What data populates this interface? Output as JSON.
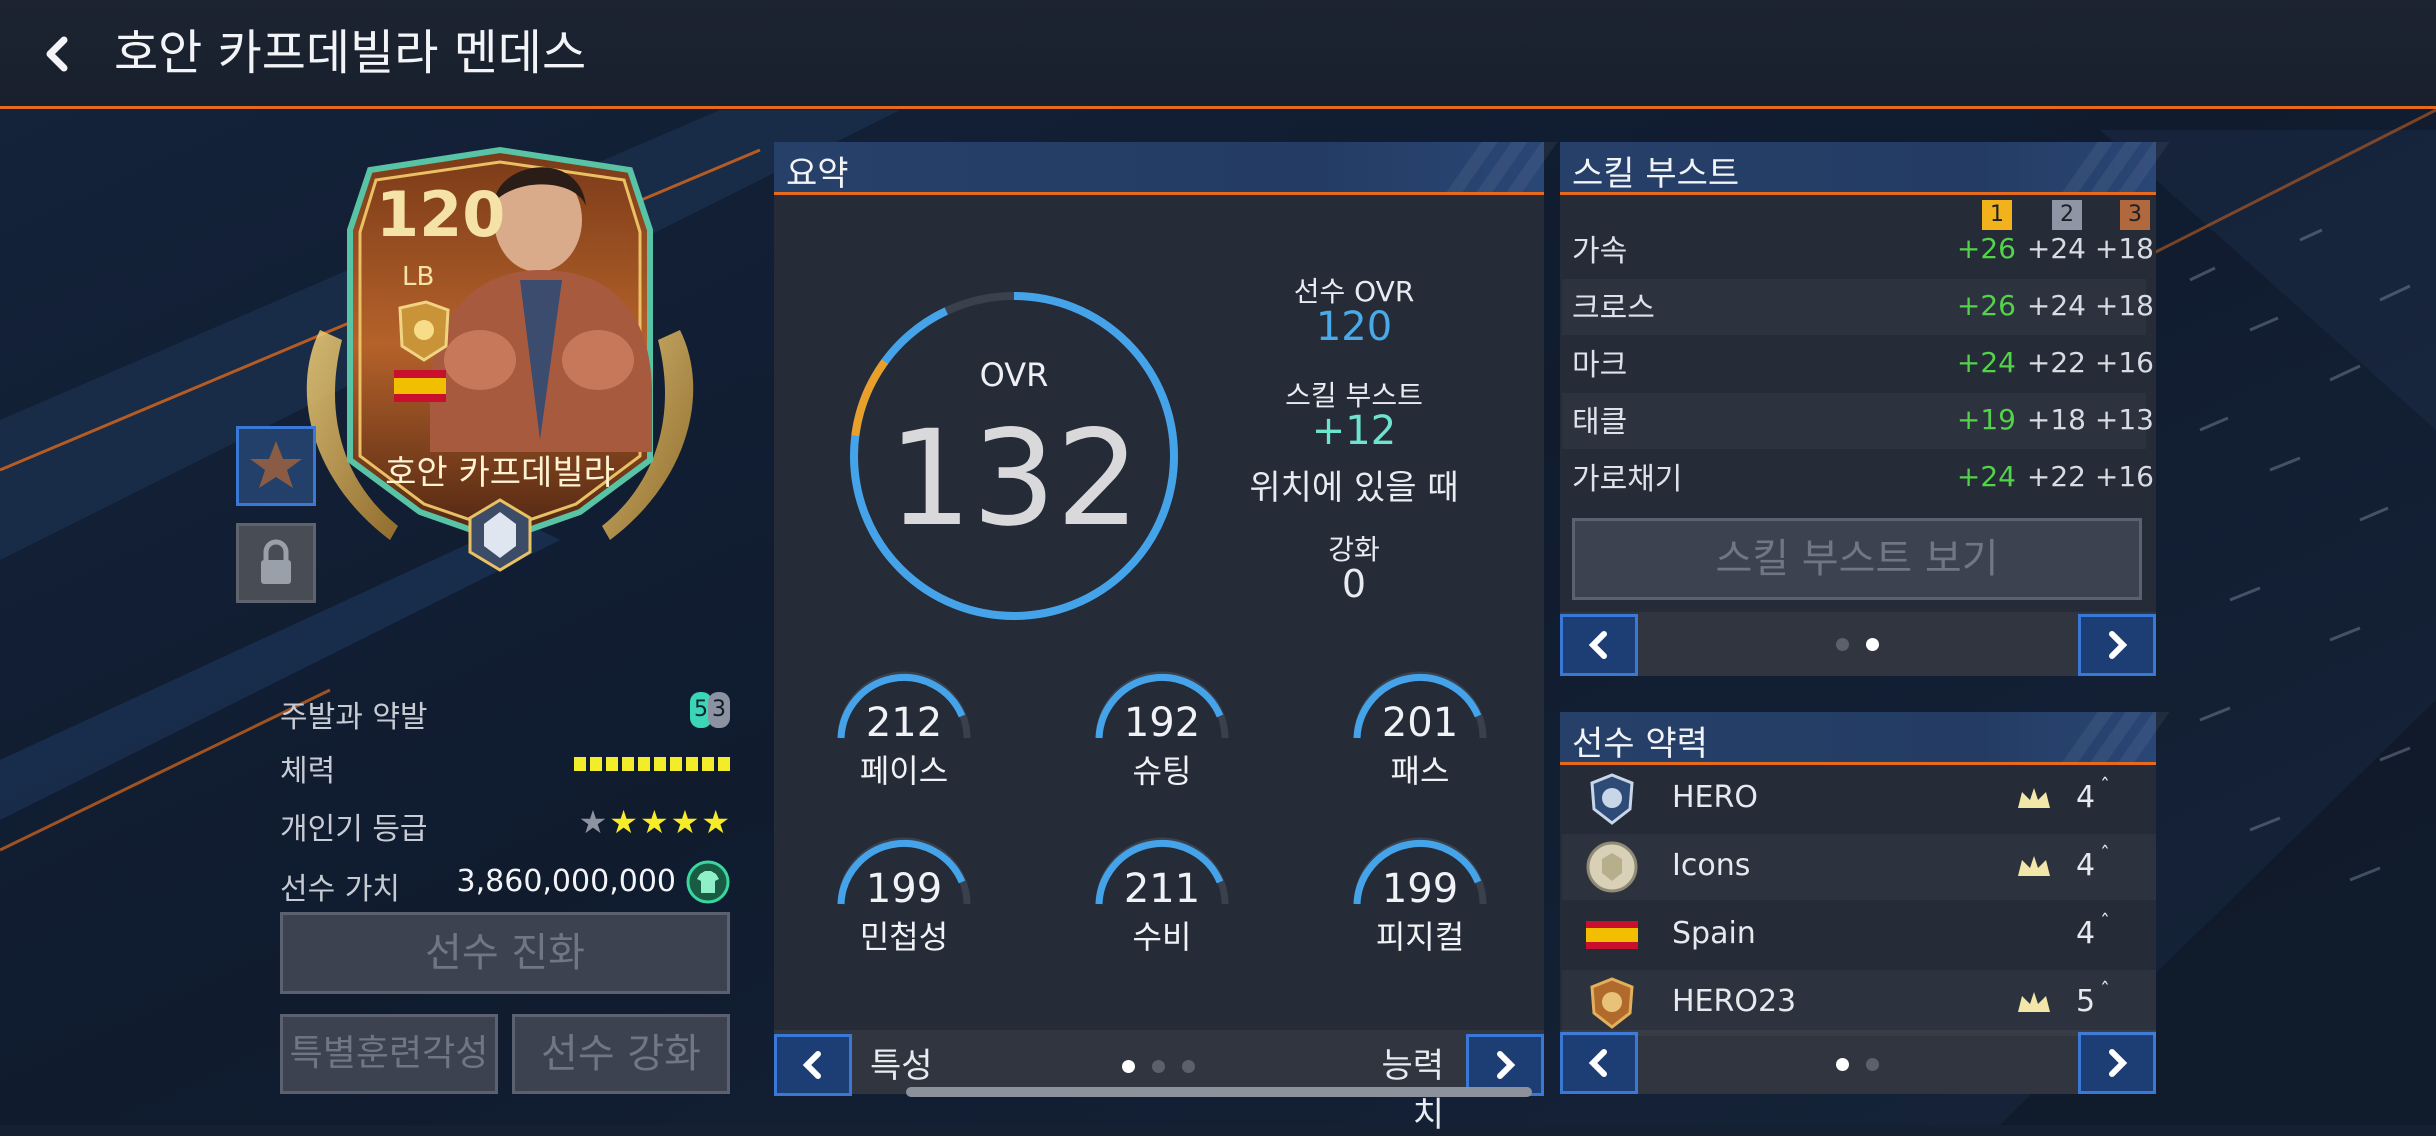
{
  "header": {
    "title": "호안 카프데빌라 멘데스"
  },
  "card": {
    "ovr": "120",
    "position": "LB",
    "name": "호안 카프데빌라"
  },
  "player_info": {
    "foot_label": "주발과 약발",
    "foot_strong": "5",
    "foot_weak": "3",
    "stamina_label": "체력",
    "stamina_level": 10,
    "popularity_label": "개인기 등급",
    "skill_stars": 4,
    "skill_stars_max": 5,
    "value_label": "선수 가치",
    "value": "3,860,000,000"
  },
  "buttons": {
    "evolution": "선수 진화",
    "special_training": "특별훈련각성",
    "enhance": "선수 강화"
  },
  "summary": {
    "title": "요약",
    "ovr_label": "OVR",
    "ovr_value": "132",
    "ovr_fill": 0.93,
    "player_ovr_label": "선수 OVR",
    "player_ovr": "120",
    "skill_boost_label": "스킬 부스트",
    "skill_boost_value": "+12",
    "skill_boost_note": "위치에 있을 때",
    "enhance_label": "강화",
    "enhance_value": "0",
    "stats": [
      {
        "value": "212",
        "label": "페이스"
      },
      {
        "value": "192",
        "label": "슈팅"
      },
      {
        "value": "201",
        "label": "패스"
      },
      {
        "value": "199",
        "label": "민첩성"
      },
      {
        "value": "211",
        "label": "수비"
      },
      {
        "value": "199",
        "label": "피지컬"
      }
    ],
    "footer_left": "특성",
    "footer_right": "능력치"
  },
  "skill_boost": {
    "title": "스킬 부스트",
    "levels": [
      "1",
      "2",
      "3"
    ],
    "level_colors": [
      "#f2b21c",
      "#8e96a6",
      "#b0683c"
    ],
    "rows": [
      {
        "name": "가속",
        "v1": "+26",
        "v2": "+24",
        "v3": "+18"
      },
      {
        "name": "크로스",
        "v1": "+26",
        "v2": "+24",
        "v3": "+18"
      },
      {
        "name": "마크",
        "v1": "+24",
        "v2": "+22",
        "v3": "+16"
      },
      {
        "name": "태클",
        "v1": "+19",
        "v2": "+18",
        "v3": "+13"
      },
      {
        "name": "가로채기",
        "v1": "+24",
        "v2": "+22",
        "v3": "+16"
      }
    ],
    "view_button": "스킬 부스트 보기"
  },
  "team_traits": {
    "title": "선수 약력",
    "rows": [
      {
        "name": "HERO",
        "count": "4",
        "icon": "hero-badge-icon"
      },
      {
        "name": "Icons",
        "count": "4",
        "icon": "icons-badge-icon"
      },
      {
        "name": "Spain",
        "count": "4",
        "icon": "spain-flag-icon"
      },
      {
        "name": "HERO23",
        "count": "5",
        "icon": "hero23-badge-icon"
      }
    ]
  },
  "colors": {
    "accent_orange": "#e56a1e",
    "ring_blue": "#45a3ea",
    "ring_orange": "#e9a02a",
    "boost_green": "#53d24a",
    "player_ovr_blue": "#4aa9e8",
    "skill_boost_teal": "#6fe2d0",
    "button_blue": "#3a78d6"
  }
}
